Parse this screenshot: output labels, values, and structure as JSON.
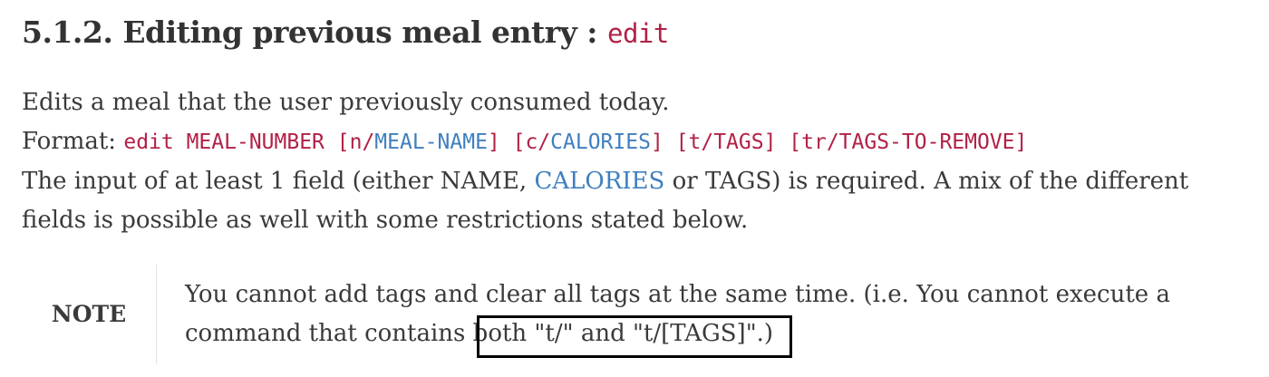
{
  "heading": {
    "number": "5.1.2.",
    "title": "Editing previous meal entry :",
    "command": "edit"
  },
  "intro": {
    "description": "Edits a meal that the user previously consumed today.",
    "format_label": "Format:",
    "format_cmd_pre": "edit MEAL-NUMBER [n/",
    "format_cmd_name": "MEAL-NAME",
    "format_cmd_mid": "] [c/",
    "format_cmd_calories": "CALORIES",
    "format_cmd_post": "] [t/TAGS] [tr/TAGS-TO-REMOVE]",
    "requirement_pre": "The input of at least 1 field (either NAME,",
    "requirement_link": "CALORIES",
    "requirement_post": "or TAGS) is required. A mix of the different",
    "requirement_line2": "fields is possible as well with some restrictions stated below."
  },
  "note": {
    "label": "NOTE",
    "line1": "You cannot add tags and clear all tags at the same time. (i.e. You cannot execute a",
    "line2_pre": "command that contains",
    "line2_highlight": "both \"t/\" and \"t/[TAGS]\".)"
  }
}
